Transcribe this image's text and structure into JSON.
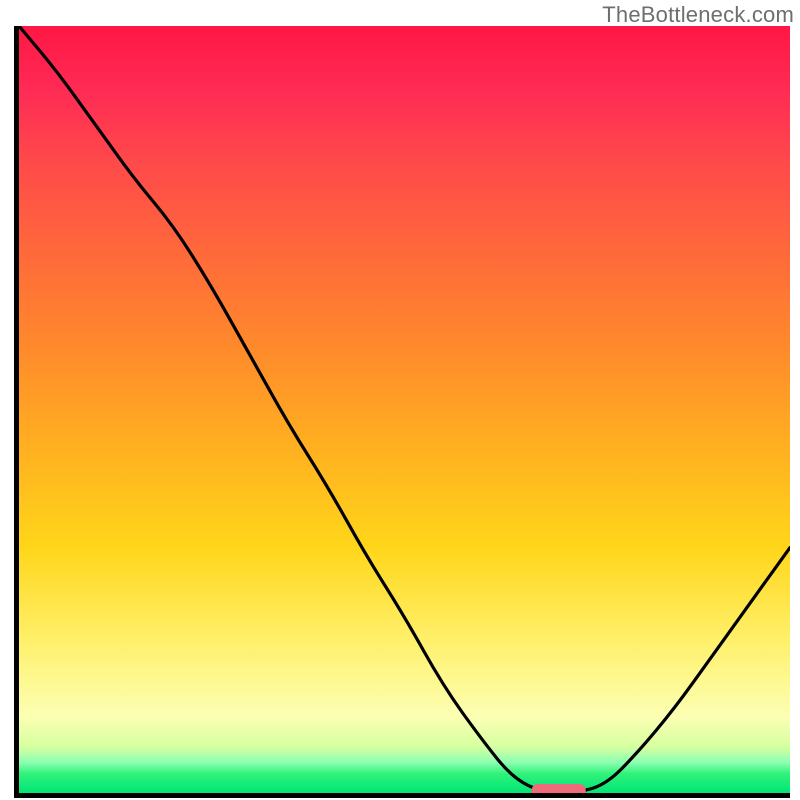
{
  "watermark": "TheBottleneck.com",
  "chart_data": {
    "type": "line",
    "title": "",
    "xlabel": "",
    "ylabel": "",
    "xlim": [
      0,
      1
    ],
    "ylim": [
      0,
      1
    ],
    "grid": false,
    "series": [
      {
        "name": "bottleneck-curve",
        "x": [
          0.0,
          0.05,
          0.1,
          0.15,
          0.2,
          0.25,
          0.3,
          0.35,
          0.4,
          0.45,
          0.5,
          0.55,
          0.6,
          0.64,
          0.68,
          0.72,
          0.76,
          0.8,
          0.85,
          0.9,
          0.95,
          1.0
        ],
        "y": [
          1.0,
          0.94,
          0.87,
          0.8,
          0.74,
          0.66,
          0.57,
          0.48,
          0.4,
          0.31,
          0.23,
          0.14,
          0.07,
          0.02,
          0.0,
          0.0,
          0.01,
          0.05,
          0.11,
          0.18,
          0.25,
          0.32
        ]
      }
    ],
    "annotations": [
      {
        "name": "optimal-marker",
        "x": 0.7,
        "y": 0.0
      }
    ],
    "background": "red-to-green-gradient"
  }
}
